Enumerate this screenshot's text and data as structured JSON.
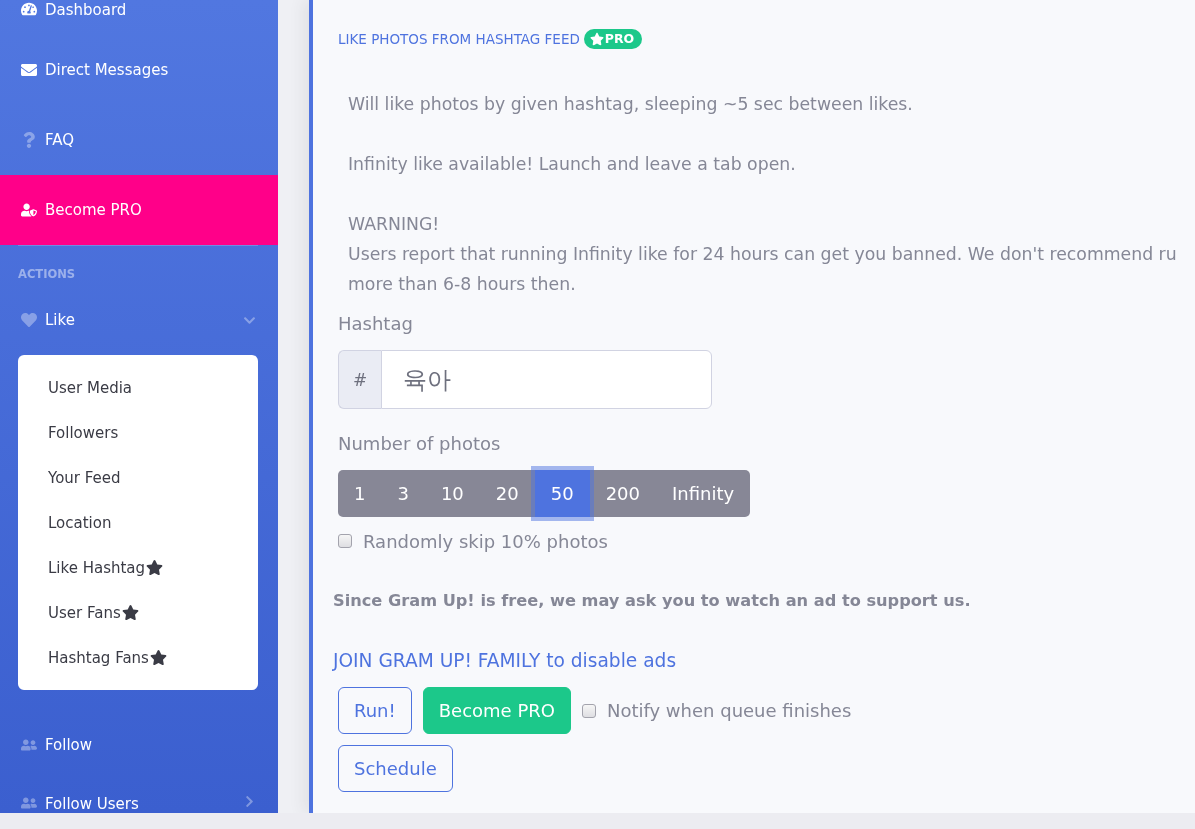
{
  "sidebar": {
    "links": [
      {
        "label": "Dashboard",
        "kind": "link"
      },
      {
        "label": "Direct Messages",
        "kind": "link"
      },
      {
        "label": "FAQ",
        "kind": "link"
      },
      {
        "label": "Become PRO",
        "kind": "promo"
      }
    ],
    "section_heading": "ACTIONS",
    "actions": [
      {
        "label": "Like",
        "kind": "group",
        "expanded": true,
        "children": [
          {
            "label": "User Media",
            "pro": false
          },
          {
            "label": "Followers",
            "pro": false
          },
          {
            "label": "Your Feed",
            "pro": false
          },
          {
            "label": "Location",
            "pro": false
          },
          {
            "label": "Like Hashtag",
            "pro": true
          },
          {
            "label": "User Fans",
            "pro": true
          },
          {
            "label": "Hashtag Fans",
            "pro": true
          }
        ]
      },
      {
        "label": "Follow",
        "kind": "link"
      },
      {
        "label": "Follow Users",
        "kind": "group",
        "expanded": false
      }
    ]
  },
  "card": {
    "title": "LIKE PHOTOS FROM HASHTAG FEED",
    "badge": "PRO",
    "description": [
      "Will like photos by given hashtag, sleeping ~5 sec between likes.",
      "Infinity like available! Launch and leave a tab open."
    ],
    "warning": {
      "title": "WARNING!",
      "lines": [
        "Users report that running Infinity like for 24 hours can get you banned. We don't recommend ru",
        "more than 6-8 hours then."
      ]
    },
    "hashtag": {
      "label": "Hashtag",
      "prefix": "#",
      "value": "육아"
    },
    "photo_count": {
      "label": "Number of photos",
      "options": [
        {
          "label": "1",
          "selected": false
        },
        {
          "label": "3",
          "selected": false
        },
        {
          "label": "10",
          "selected": false
        },
        {
          "label": "20",
          "selected": false
        },
        {
          "label": "50",
          "selected": true
        },
        {
          "label": "200",
          "selected": false
        },
        {
          "label": "Infinity",
          "selected": false
        }
      ]
    },
    "skip_option": {
      "label": "Randomly skip 10% photos",
      "checked": false
    },
    "ad_notice": "Since Gram Up! is free, we may ask you to watch an ad to support us.",
    "family_link": "JOIN GRAM UP! FAMILY to disable ads",
    "buttons": [
      {
        "label": "Run!",
        "kind": "outline"
      },
      {
        "label": "Become PRO",
        "kind": "success"
      }
    ],
    "notify_option": {
      "label": "Notify when queue finishes",
      "checked": false
    },
    "schedule_button": {
      "label": "Schedule",
      "kind": "outline"
    }
  }
}
